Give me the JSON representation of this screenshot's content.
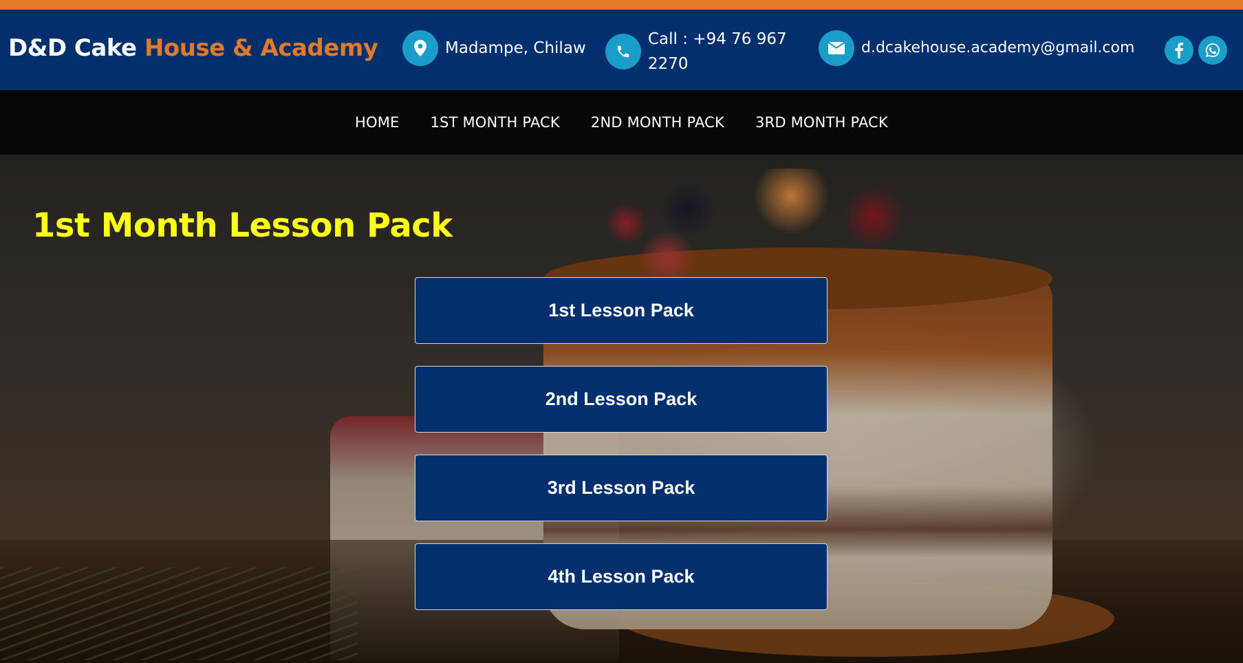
{
  "header": {
    "brand_part1": "D&D Cake ",
    "brand_part2": "House & Academy",
    "location": "Madampe, Chilaw",
    "call": "Call : +94 76 967 2270",
    "email": "d.dcakehouse.academy@gmail.com",
    "icons": {
      "location": "map-pin-icon",
      "call": "phone-icon",
      "email": "envelope-icon",
      "facebook": "facebook-icon",
      "whatsapp": "whatsapp-icon"
    }
  },
  "nav": {
    "items": [
      {
        "label": "HOME"
      },
      {
        "label": "1ST MONTH PACK"
      },
      {
        "label": "2ND MONTH PACK"
      },
      {
        "label": "3RD MONTH PACK"
      }
    ]
  },
  "main": {
    "title": "1st Month Lesson Pack",
    "lessons": [
      {
        "label": "1st Lesson Pack"
      },
      {
        "label": "2nd Lesson Pack"
      },
      {
        "label": "3rd Lesson Pack"
      },
      {
        "label": "4th Lesson Pack"
      }
    ]
  },
  "colors": {
    "accent_orange": "#e07b2a",
    "header_blue": "#02306f",
    "icon_blue": "#1a9ec9",
    "title_yellow": "#ffff1a",
    "nav_black": "#070707"
  }
}
